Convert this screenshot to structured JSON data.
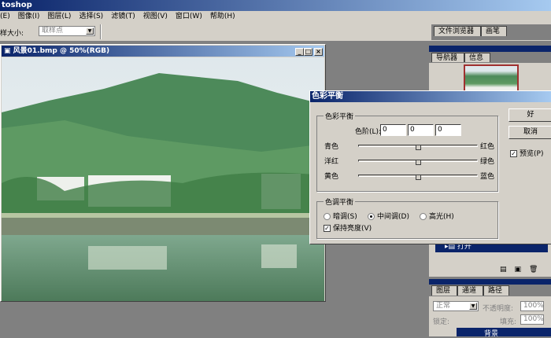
{
  "app": {
    "title": "toshop"
  },
  "menu": [
    "(E)",
    "图像(I)",
    "图层(L)",
    "选择(S)",
    "滤镜(T)",
    "视图(V)",
    "窗口(W)",
    "帮助(H)"
  ],
  "options": {
    "sample_label": "样大小:",
    "sample_value": "取样点"
  },
  "document": {
    "title": "风景01.bmp @ 50%(RGB)"
  },
  "palette_well": {
    "tabs": [
      "文件浏览器",
      "画笔"
    ]
  },
  "navigator": {
    "tabs": [
      "导航器",
      "信息"
    ]
  },
  "history": {
    "item": "打开"
  },
  "layers": {
    "tabs": [
      "图层",
      "通道",
      "路径"
    ],
    "blend_mode": "正常",
    "opacity_label": "不透明度:",
    "opacity": "100%",
    "lock_label": "锁定:",
    "fill_label": "填充:",
    "fill": "100%",
    "layer_name": "背景"
  },
  "dialog": {
    "title": "色彩平衡",
    "group1": "色彩平衡",
    "levels_label": "色阶(L):",
    "levels": [
      "0",
      "0",
      "0"
    ],
    "sliders": [
      {
        "left": "青色",
        "right": "红色",
        "value": 0
      },
      {
        "left": "洋红",
        "right": "绿色",
        "value": 0
      },
      {
        "left": "黄色",
        "right": "蓝色",
        "value": 0
      }
    ],
    "group2": "色调平衡",
    "tones": [
      "暗调(S)",
      "中间调(D)",
      "高光(H)"
    ],
    "selected_tone": "中间调(D)",
    "preserve_label": "保持亮度(V)",
    "preserve_checked": true,
    "ok": "好",
    "cancel": "取消",
    "preview_label": "预览(P)",
    "preview_checked": true
  }
}
